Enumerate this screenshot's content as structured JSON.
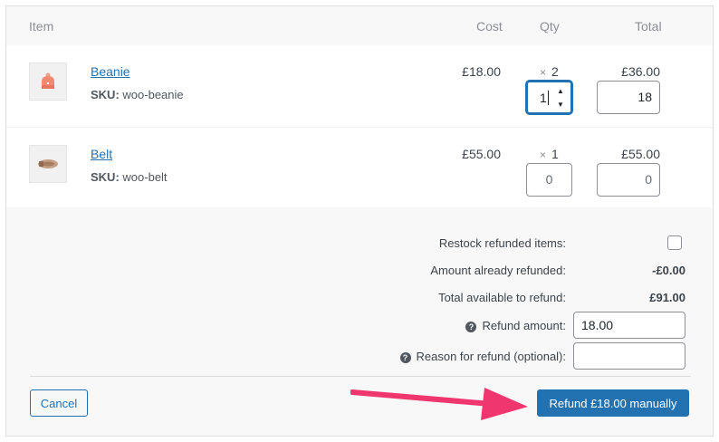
{
  "header": {
    "item": "Item",
    "cost": "Cost",
    "qty": "Qty",
    "total": "Total"
  },
  "items": [
    {
      "name": "Beanie",
      "sku_label": "SKU:",
      "sku": "woo-beanie",
      "cost": "£18.00",
      "qty_prefix": "×",
      "qty": "2",
      "total": "£36.00",
      "refund_qty": "1",
      "refund_total": "18"
    },
    {
      "name": "Belt",
      "sku_label": "SKU:",
      "sku": "woo-belt",
      "cost": "£55.00",
      "qty_prefix": "×",
      "qty": "1",
      "total": "£55.00",
      "refund_qty": "0",
      "refund_total": "0"
    }
  ],
  "refund": {
    "restock_label": "Restock refunded items:",
    "already_label": "Amount already refunded:",
    "already_value": "-£0.00",
    "available_label": "Total available to refund:",
    "available_value": "£91.00",
    "amount_label": "Refund amount:",
    "amount_value": "18.00",
    "reason_label": "Reason for refund (optional):",
    "reason_value": ""
  },
  "buttons": {
    "cancel": "Cancel",
    "refund": "Refund £18.00 manually"
  },
  "icons": {
    "help": "?"
  },
  "colors": {
    "accent": "#2271b1",
    "arrow": "#f0366e"
  }
}
